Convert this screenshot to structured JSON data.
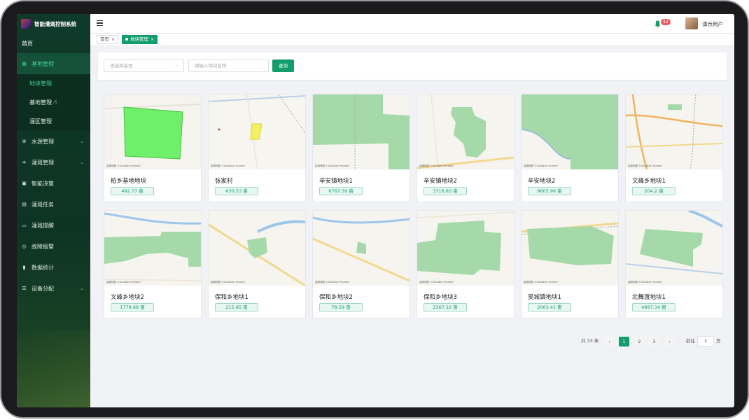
{
  "app": {
    "title": "智能灌溉控制系统"
  },
  "sidebar": {
    "home": "首页",
    "groups": [
      {
        "label": "基地管理",
        "icon": "grid-icon",
        "active": true,
        "children": [
          {
            "label": "地块管理",
            "active": true
          },
          {
            "label": "基地管理",
            "active": false
          },
          {
            "label": "灌区管理",
            "active": false
          }
        ]
      },
      {
        "label": "水源管理",
        "icon": "water-source-icon"
      },
      {
        "label": "灌溉管理",
        "icon": "sliders-icon"
      },
      {
        "label": "智能决策",
        "icon": "decision-icon"
      },
      {
        "label": "灌溉任务",
        "icon": "calendar-icon"
      },
      {
        "label": "灌溉提醒",
        "icon": "message-icon"
      },
      {
        "label": "故障报警",
        "icon": "alarm-icon"
      },
      {
        "label": "数据统计",
        "icon": "bar-chart-icon"
      },
      {
        "label": "设备分配",
        "icon": "list-icon"
      }
    ]
  },
  "header": {
    "notification_count": "42",
    "user_name": "演示用户"
  },
  "tabs": [
    {
      "label": "首页",
      "active": false
    },
    {
      "label": "地块管理",
      "active": true
    }
  ],
  "filter": {
    "base_select_placeholder": "请选择基地",
    "name_input_placeholder": "请输入地块名称",
    "query_button": "查询"
  },
  "map_attribution": "高德地图  ©AutoNavi  Huawei",
  "plots": [
    {
      "name": "柏乡基地地块",
      "area": "492.77 亩"
    },
    {
      "name": "张家村",
      "area": "630.53 亩"
    },
    {
      "name": "辛安镇地块1",
      "area": "8767.39 亩"
    },
    {
      "name": "辛安镇地块2",
      "area": "3716.83 亩"
    },
    {
      "name": "辛安地块2",
      "area": "9605.96 亩"
    },
    {
      "name": "文峰乡地块1",
      "area": "204.2 亩"
    },
    {
      "name": "文峰乡地块2",
      "area": "1779.68 亩"
    },
    {
      "name": "保和乡地块1",
      "area": "215.85 亩"
    },
    {
      "name": "保和乡地块2",
      "area": "78.59 亩"
    },
    {
      "name": "保和乡地块3",
      "area": "2367.22 亩"
    },
    {
      "name": "吴城镇地块1",
      "area": "2003.41 亩"
    },
    {
      "name": "北舞渡地块1",
      "area": "4897.34 亩"
    }
  ],
  "pagination": {
    "total": "共 33 条",
    "prev": "‹",
    "pages": [
      "1",
      "2",
      "3"
    ],
    "current": "1",
    "next": "›",
    "goto_label": "前往",
    "goto_value": "1",
    "goto_suffix": "页"
  },
  "colors": {
    "primary": "#139d6d",
    "sidebar_bg": "#0f3a2a",
    "plot_fill": "#a6d9a9"
  }
}
